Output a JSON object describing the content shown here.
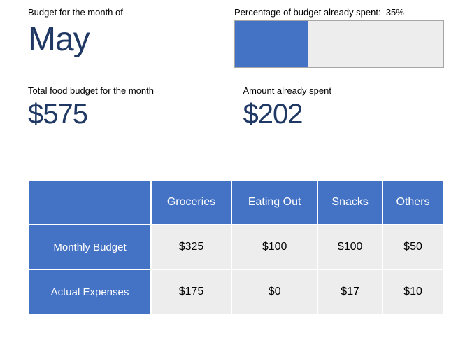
{
  "header": {
    "month_label": "Budget for the month of",
    "month_value": "May",
    "percent_label_prefix": "Percentage of budget already spent:",
    "percent_text": "35%",
    "percent_value": 35
  },
  "amounts": {
    "budget_label": "Total food budget for the month",
    "budget_value": "$575",
    "spent_label": "Amount already spent",
    "spent_value": "$202"
  },
  "table": {
    "columns": [
      "Groceries",
      "Eating Out",
      "Snacks",
      "Others"
    ],
    "rows": [
      {
        "label": "Monthly Budget",
        "values": [
          "$325",
          "$100",
          "$100",
          "$50"
        ]
      },
      {
        "label": "Actual Expenses",
        "values": [
          "$175",
          "$0",
          "$17",
          "$10"
        ]
      }
    ]
  }
}
